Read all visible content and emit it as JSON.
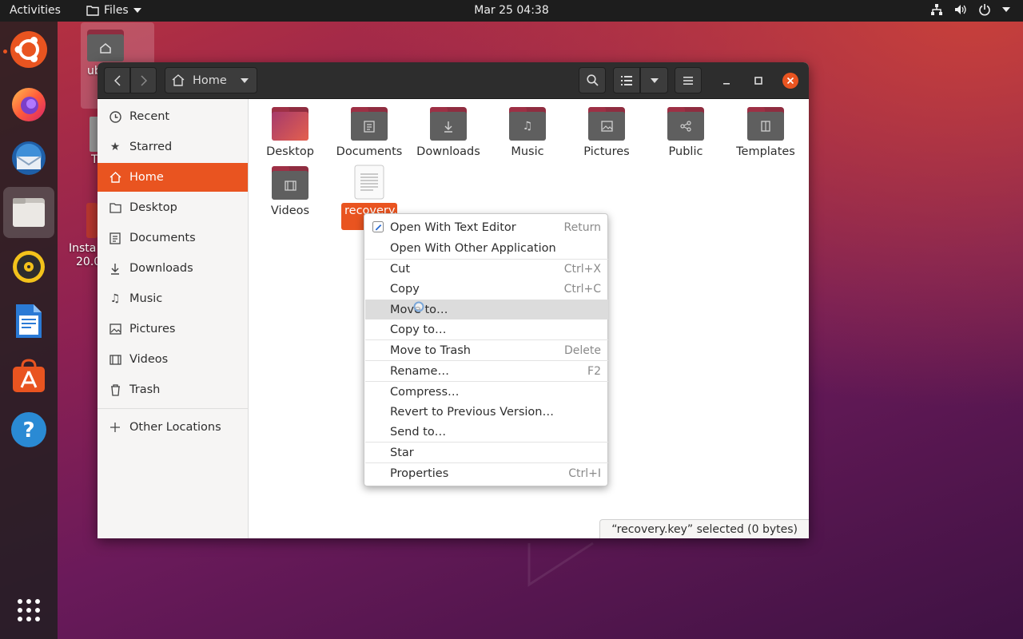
{
  "topbar": {
    "activities": "Activities",
    "app_name": "Files",
    "clock": "Mar 25  04:38"
  },
  "desktop": {
    "home_label": "ub",
    "trash_label": "T",
    "installer_label_1": "Insta",
    "installer_label_2": "20.0"
  },
  "window": {
    "path_label": "Home",
    "sidebar": [
      {
        "label": "Recent",
        "icon": "clock-icon"
      },
      {
        "label": "Starred",
        "icon": "star-icon"
      },
      {
        "label": "Home",
        "icon": "home-icon",
        "selected": true
      },
      {
        "label": "Desktop",
        "icon": "folder-icon"
      },
      {
        "label": "Documents",
        "icon": "document-icon"
      },
      {
        "label": "Downloads",
        "icon": "download-icon"
      },
      {
        "label": "Music",
        "icon": "music-icon"
      },
      {
        "label": "Pictures",
        "icon": "picture-icon"
      },
      {
        "label": "Videos",
        "icon": "video-icon"
      },
      {
        "label": "Trash",
        "icon": "trash-icon"
      }
    ],
    "other_locations": "Other Locations",
    "files": [
      {
        "name": "Desktop",
        "icon": "desktop-folder-icon"
      },
      {
        "name": "Documents",
        "icon": "documents-folder-icon"
      },
      {
        "name": "Downloads",
        "icon": "downloads-folder-icon"
      },
      {
        "name": "Music",
        "icon": "music-folder-icon"
      },
      {
        "name": "Pictures",
        "icon": "pictures-folder-icon"
      },
      {
        "name": "Public",
        "icon": "public-folder-icon"
      },
      {
        "name": "Templates",
        "icon": "templates-folder-icon"
      },
      {
        "name": "Videos",
        "icon": "videos-folder-icon"
      },
      {
        "name": "recovery.",
        "icon": "text-file-icon",
        "selected": true
      }
    ],
    "status": "“recovery.key” selected  (0 bytes)"
  },
  "context_menu": {
    "items": [
      {
        "label": "Open With Text Editor",
        "accel": "Return"
      },
      {
        "label": "Open With Other Application",
        "accel": ""
      },
      {
        "label": "Cut",
        "accel": "Ctrl+X"
      },
      {
        "label": "Copy",
        "accel": "Ctrl+C"
      },
      {
        "label": "Move to…",
        "accel": "",
        "hovered": true
      },
      {
        "label": "Copy to…",
        "accel": ""
      },
      {
        "label": "Move to Trash",
        "accel": "Delete"
      },
      {
        "label": "Rename…",
        "accel": "F2"
      },
      {
        "label": "Compress…",
        "accel": ""
      },
      {
        "label": "Revert to Previous Version…",
        "accel": ""
      },
      {
        "label": "Send to…",
        "accel": ""
      },
      {
        "label": "Star",
        "accel": ""
      },
      {
        "label": "Properties",
        "accel": "Ctrl+I"
      }
    ]
  },
  "colors": {
    "accent": "#e95420",
    "topbar": "#1d1d1d",
    "headerbar": "#2d2d2d"
  }
}
